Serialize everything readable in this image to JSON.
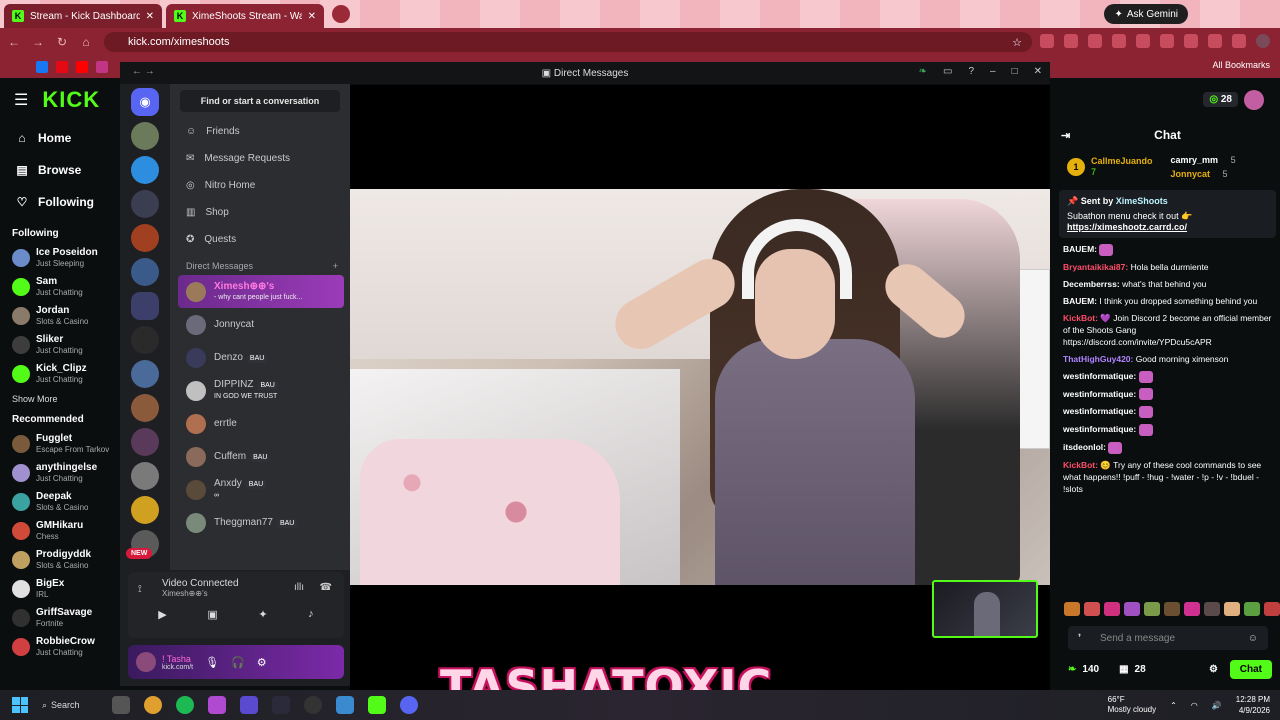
{
  "browser": {
    "tabs": [
      {
        "title": "Stream - Kick Dashboard",
        "active": false
      },
      {
        "title": "XimeShoots Stream - Watch Liv",
        "active": true
      }
    ],
    "gemini_label": "Ask Gemini",
    "url": "kick.com/ximeshoots",
    "all_bookmarks": "All Bookmarks"
  },
  "kick": {
    "nav": [
      {
        "label": "Home",
        "icon": "home-icon"
      },
      {
        "label": "Browse",
        "icon": "browse-icon"
      },
      {
        "label": "Following",
        "icon": "heart-icon"
      }
    ],
    "following_title": "Following",
    "following": [
      {
        "name": "Ice Poseidon",
        "sub": "Just Sleeping",
        "color": "#6b8cc9"
      },
      {
        "name": "Sam",
        "sub": "Just Chatting",
        "color": "#53fc18"
      },
      {
        "name": "Jordan",
        "sub": "Slots & Casino",
        "color": "#8a7a6a"
      },
      {
        "name": "Sliker",
        "sub": "Just Chatting",
        "color": "#3d3d3d"
      },
      {
        "name": "Kick_Clipz",
        "sub": "Just Chatting",
        "color": "#53fc18"
      }
    ],
    "show_more": "Show More",
    "recommended_title": "Recommended",
    "recommended": [
      {
        "name": "Fugglet",
        "sub": "Escape From Tarkov",
        "color": "#7a5a3a"
      },
      {
        "name": "anythingelse",
        "sub": "Just Chatting",
        "color": "#a090d0"
      },
      {
        "name": "Deepak",
        "sub": "Slots & Casino",
        "color": "#3aa3a0"
      },
      {
        "name": "GMHikaru",
        "sub": "Chess",
        "color": "#d04a3a"
      },
      {
        "name": "Prodigyddk",
        "sub": "Slots & Casino",
        "color": "#c0a060"
      },
      {
        "name": "BigEx",
        "sub": "IRL",
        "color": "#e0e0e0"
      },
      {
        "name": "GriffSavage",
        "sub": "Fortnite",
        "color": "#303030"
      },
      {
        "name": "RobbieCrow",
        "sub": "Just Chatting",
        "color": "#d04040"
      }
    ],
    "top_count": "28"
  },
  "discord": {
    "title": "Direct Messages",
    "find_placeholder": "Find or start a conversation",
    "nav": [
      {
        "label": "Friends",
        "icon": "friends-icon"
      },
      {
        "label": "Message Requests",
        "icon": "mail-icon"
      },
      {
        "label": "Nitro Home",
        "icon": "nitro-icon"
      },
      {
        "label": "Shop",
        "icon": "shop-icon"
      },
      {
        "label": "Quests",
        "icon": "quests-icon"
      }
    ],
    "dm_header": "Direct Messages",
    "dms": [
      {
        "name": "Ximesh⊕⊕'s",
        "sub": "- why cant people just fuck...",
        "active": true,
        "badge": ""
      },
      {
        "name": "Jonnycat",
        "sub": "",
        "active": false,
        "badge": ""
      },
      {
        "name": "Denzo",
        "sub": "",
        "active": false,
        "badge": "BAU"
      },
      {
        "name": "DIPPINZ",
        "sub": "IN GOD WE TRUST",
        "active": false,
        "badge": "BAU"
      },
      {
        "name": "errtle",
        "sub": "",
        "active": false,
        "badge": ""
      },
      {
        "name": "Cuffem",
        "sub": "",
        "active": false,
        "badge": "BAU"
      },
      {
        "name": "Anxdy",
        "sub": "∞",
        "active": false,
        "badge": "BAU"
      },
      {
        "name": "Theggman77",
        "sub": "",
        "active": false,
        "badge": "BAU"
      }
    ],
    "new_badge": "NEW",
    "voice_title": "Video Connected",
    "voice_sub": "Ximesh⊕⊕'s",
    "user_name": "! Tasha",
    "user_sub": "kick.com/t"
  },
  "stream": {
    "overlay_name": "TASHATOXIC"
  },
  "chat": {
    "title": "Chat",
    "leaders": [
      {
        "rank": "1",
        "name": "CallmeJuando",
        "count": "7"
      },
      {
        "name": "camry_mm",
        "count": "5"
      },
      {
        "name": "Jonnycat",
        "count": "5"
      }
    ],
    "pinned_by_label": "Sent by",
    "pinned_by": "XimeShoots",
    "pinned_text": "Subathon menu check it out 👉",
    "pinned_link": "https://ximeshootz.carrd.co/",
    "messages": [
      {
        "user": "BAUEM:",
        "text": "",
        "color": "#ffffff"
      },
      {
        "user": "Bryantaikikai87:",
        "text": "Hola bella durmiente",
        "color": "#ff4d6a"
      },
      {
        "user": "Decemberrss:",
        "text": "what's that behind you",
        "color": "#ffffff"
      },
      {
        "user": "BAUEM:",
        "text": "I think you dropped something behind you",
        "color": "#ffffff"
      },
      {
        "user": "KickBot:",
        "text": "💜 Join Discord 2 become an official member of the Shoots Gang https://discord.com/invite/YPDcu5cAPR",
        "color": "#ff4d6a"
      },
      {
        "user": "ThatHighGuy420:",
        "text": "Good morning ximenson",
        "color": "#b084ff"
      },
      {
        "user": "westinformatique:",
        "text": "",
        "color": "#ffffff"
      },
      {
        "user": "westinformatique:",
        "text": "",
        "color": "#ffffff"
      },
      {
        "user": "westinformatique:",
        "text": "",
        "color": "#ffffff"
      },
      {
        "user": "westinformatique:",
        "text": "",
        "color": "#ffffff"
      },
      {
        "user": "itsdeonlol:",
        "text": "",
        "color": "#ffffff"
      },
      {
        "user": "KickBot:",
        "text": "😊 Try any of these cool commands to see what happens!! !puff - !hug - !water - !p - !v - !bduel - !slots",
        "color": "#ff4d6a"
      }
    ],
    "send_placeholder": "Send a message",
    "points": "140",
    "viewers": "28",
    "chat_button": "Chat"
  },
  "taskbar": {
    "search": "Search",
    "weather_temp": "66°F",
    "weather_desc": "Mostly cloudy",
    "time": "12:28 PM",
    "date": "4/9/2026"
  }
}
